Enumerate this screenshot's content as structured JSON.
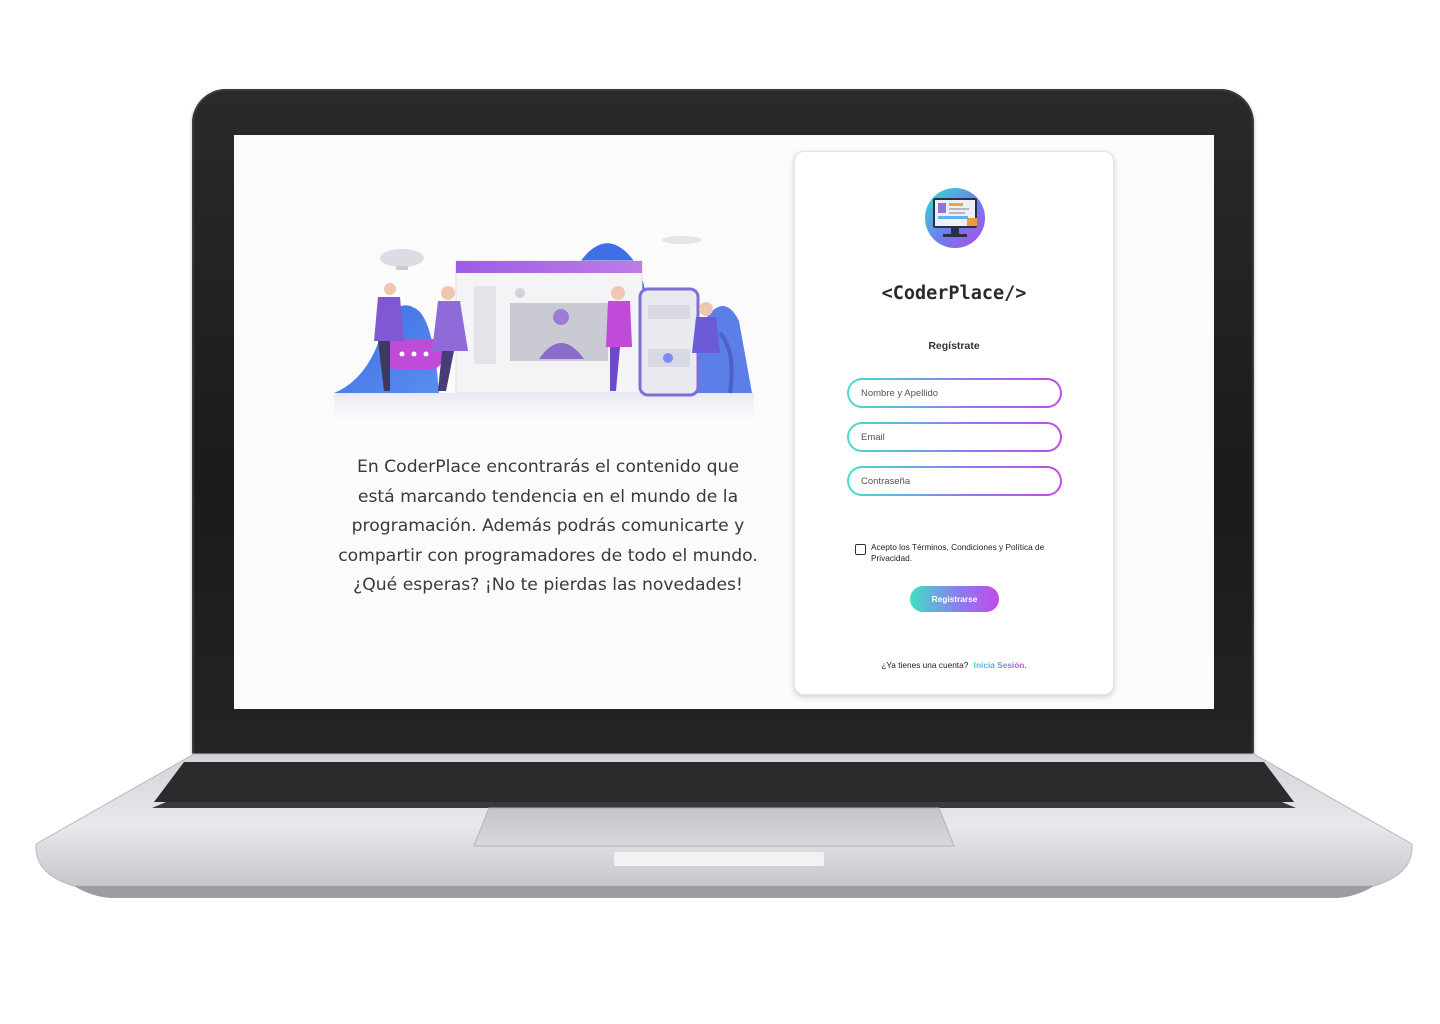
{
  "hero": {
    "description": "En CoderPlace encontrarás el contenido que está marcando tendencia en el mundo de la programación. Además podrás comunicarte y compartir con programadores de todo el mundo. ¿Qué esperas? ¡No te pierdas las novedades!"
  },
  "card": {
    "brand": "<CoderPlace/>",
    "subtitle": "Regístrate",
    "fields": {
      "name_placeholder": "Nombre y Apellido",
      "email_placeholder": "Email",
      "password_placeholder": "Contraseña"
    },
    "terms_label": "Acepto los Términos, Condiciones y Política de Privacidad.",
    "terms_checked": false,
    "submit_label": "Registrarse",
    "login_prompt": "¿Ya tienes una cuenta?",
    "login_link": "Inicia Sesión."
  },
  "theme": {
    "gradient_start": "#3fe0c6",
    "gradient_mid": "#8d7cf0",
    "gradient_end": "#c04be6"
  },
  "icons": [
    "laptop-frame",
    "hero-illustration",
    "brand-logo-icon",
    "checkbox-icon"
  ]
}
